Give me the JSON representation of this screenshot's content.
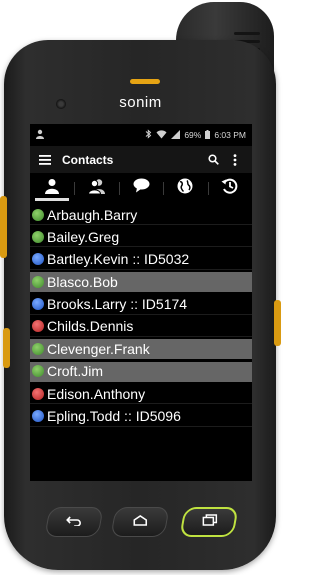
{
  "device": {
    "brand": "sonim"
  },
  "statusbar": {
    "battery": "69%",
    "time": "6:03 PM"
  },
  "appbar": {
    "title": "Contacts"
  },
  "tabs": [
    {
      "icon": "person-icon",
      "active": true
    },
    {
      "icon": "group-icon",
      "active": false
    },
    {
      "icon": "chat-icon",
      "active": false
    },
    {
      "icon": "globe-icon",
      "active": false
    },
    {
      "icon": "history-icon",
      "active": false
    }
  ],
  "contacts": [
    {
      "name": "Arbaugh.Barry",
      "status": "green",
      "selected": false
    },
    {
      "name": "Bailey.Greg",
      "status": "green",
      "selected": false
    },
    {
      "name": "Bartley.Kevin :: ID5032",
      "status": "blue",
      "selected": false
    },
    {
      "name": "Blasco.Bob",
      "status": "green",
      "selected": true
    },
    {
      "name": "Brooks.Larry :: ID5174",
      "status": "blue",
      "selected": false
    },
    {
      "name": "Childs.Dennis",
      "status": "red",
      "selected": false
    },
    {
      "name": "Clevenger.Frank",
      "status": "green",
      "selected": true
    },
    {
      "name": "Croft.Jim",
      "status": "green",
      "selected": true
    },
    {
      "name": "Edison.Anthony",
      "status": "red",
      "selected": false
    },
    {
      "name": "Epling.Todd :: ID5096",
      "status": "blue",
      "selected": false
    }
  ],
  "colors": {
    "online": "#4caf3a",
    "busy": "#d63b3b",
    "radio": "#2f6fe0",
    "selected_row": "#666666",
    "accent": "#e6a414",
    "highlight_button": "#bfe240"
  }
}
